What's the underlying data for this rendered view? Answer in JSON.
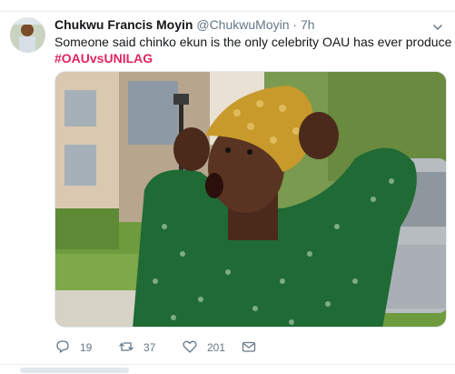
{
  "tweet": {
    "display_name": "Chukwu Francis Moyin",
    "handle": "@ChukwuMoyin",
    "separator": "·",
    "time": "7h",
    "text": "Someone said chinko ekun is the only celebrity OAU has ever produce",
    "hashtag": "#OAUvsUNILAG",
    "counts": {
      "replies": "19",
      "retweets": "37",
      "likes": "201"
    }
  },
  "icons": {
    "menu": "chevron-down-icon",
    "reply": "reply-icon",
    "retweet": "retweet-icon",
    "like": "heart-icon",
    "dm": "envelope-icon"
  },
  "colors": {
    "hashtag": "#e0245e",
    "meta": "#657786",
    "text": "#14171a"
  }
}
